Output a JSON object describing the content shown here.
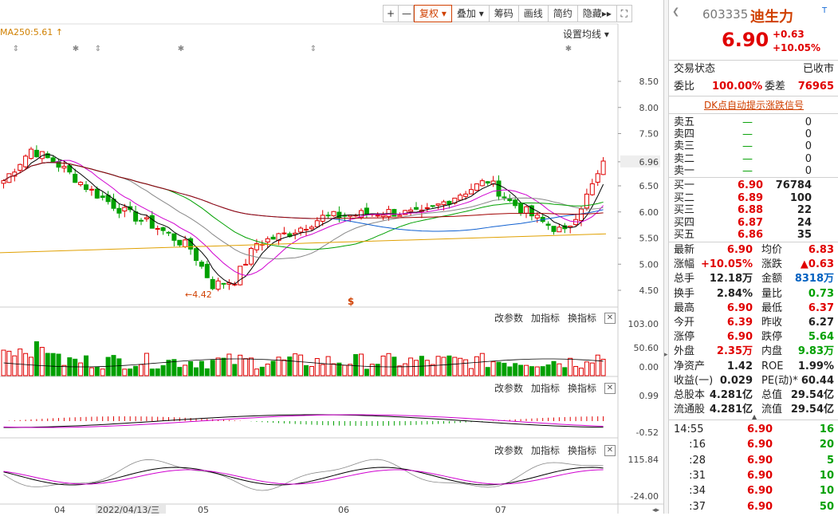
{
  "toolbar": {
    "plus": "+",
    "minus": "—",
    "restore": "复权",
    "overlay": "叠加",
    "chips": "筹码",
    "draw": "画线",
    "simple": "简约",
    "hide": "隐藏",
    "hide_arrow": "▸▸"
  },
  "chart": {
    "ma_label": "MA250:5.61",
    "set_ma": "设置均线",
    "y_ticks": [
      "8.50",
      "8.00",
      "7.50",
      "6.96",
      "6.50",
      "6.00",
      "5.50",
      "5.00",
      "4.50"
    ],
    "low_label": "4.42",
    "vol_ticks": [
      "103.00",
      "50.60",
      "0.00"
    ],
    "macd_ticks": [
      "0.99",
      "-0.52"
    ],
    "kdj_ticks": [
      "115.84",
      "-24.00"
    ],
    "x_labels": [
      "04",
      "2022/04/13/三",
      "05",
      "06",
      "07"
    ],
    "panel_buttons": [
      "改参数",
      "加指标",
      "换指标"
    ],
    "close_glyph": "✕",
    "dollar_mark": "$"
  },
  "quote": {
    "code": "603335",
    "name": "迪生力",
    "price": "6.90",
    "change": "+0.63",
    "change_pct": "+10.05%",
    "trade_status_label": "交易状态",
    "trade_status": "已收市",
    "weibi_label": "委比",
    "weibi": "100.00%",
    "weicha_label": "委差",
    "weicha": "76965",
    "dk_link": "DK点自动提示涨跌信号"
  },
  "order_book": {
    "sells": [
      {
        "label": "卖五",
        "price": "—",
        "vol": "0"
      },
      {
        "label": "卖四",
        "price": "—",
        "vol": "0"
      },
      {
        "label": "卖三",
        "price": "—",
        "vol": "0"
      },
      {
        "label": "卖二",
        "price": "—",
        "vol": "0"
      },
      {
        "label": "卖一",
        "price": "—",
        "vol": "0"
      }
    ],
    "buys": [
      {
        "label": "买一",
        "price": "6.90",
        "vol": "76784"
      },
      {
        "label": "买二",
        "price": "6.89",
        "vol": "100"
      },
      {
        "label": "买三",
        "price": "6.88",
        "vol": "22"
      },
      {
        "label": "买四",
        "price": "6.87",
        "vol": "24"
      },
      {
        "label": "买五",
        "price": "6.86",
        "vol": "35"
      }
    ]
  },
  "stats": [
    {
      "l1": "最新",
      "v1": "6.90",
      "c1": "red",
      "l2": "均价",
      "v2": "6.83",
      "c2": "red"
    },
    {
      "l1": "涨幅",
      "v1": "+10.05%",
      "c1": "red",
      "l2": "涨跌",
      "v2": "▲0.63",
      "c2": "red"
    },
    {
      "l1": "总手",
      "v1": "12.18万",
      "c1": "",
      "l2": "金额",
      "v2": "8318万",
      "c2": "blue"
    },
    {
      "l1": "换手",
      "v1": "2.84%",
      "c1": "",
      "l2": "量比",
      "v2": "0.73",
      "c2": "green"
    },
    {
      "l1": "最高",
      "v1": "6.90",
      "c1": "red",
      "l2": "最低",
      "v2": "6.37",
      "c2": "red"
    },
    {
      "l1": "今开",
      "v1": "6.39",
      "c1": "red",
      "l2": "昨收",
      "v2": "6.27",
      "c2": ""
    },
    {
      "l1": "涨停",
      "v1": "6.90",
      "c1": "red",
      "l2": "跌停",
      "v2": "5.64",
      "c2": "green"
    },
    {
      "l1": "外盘",
      "v1": "2.35万",
      "c1": "red",
      "l2": "内盘",
      "v2": "9.83万",
      "c2": "green"
    },
    {
      "l1": "净资产",
      "v1": "1.42",
      "c1": "",
      "l2": "ROE",
      "v2": "1.99%",
      "c2": ""
    },
    {
      "l1": "收益(一)",
      "v1": "0.029",
      "c1": "",
      "l2": "PE(动)*",
      "v2": "60.44",
      "c2": ""
    },
    {
      "l1": "总股本",
      "v1": "4.281亿",
      "c1": "",
      "l2": "总值",
      "v2": "29.54亿",
      "c2": ""
    },
    {
      "l1": "流通股",
      "v1": "4.281亿",
      "c1": "",
      "l2": "流值",
      "v2": "29.54亿",
      "c2": ""
    }
  ],
  "ticks": [
    {
      "time": "14:55",
      "price": "6.90",
      "vol": "16"
    },
    {
      "time": ":16",
      "price": "6.90",
      "vol": "20"
    },
    {
      "time": ":28",
      "price": "6.90",
      "vol": "5"
    },
    {
      "time": ":31",
      "price": "6.90",
      "vol": "10"
    },
    {
      "time": ":34",
      "price": "6.90",
      "vol": "10"
    },
    {
      "time": ":37",
      "price": "6.90",
      "vol": "50"
    }
  ],
  "colors": {
    "up": "#e00000",
    "down": "#00a000",
    "accent": "#d04000"
  }
}
